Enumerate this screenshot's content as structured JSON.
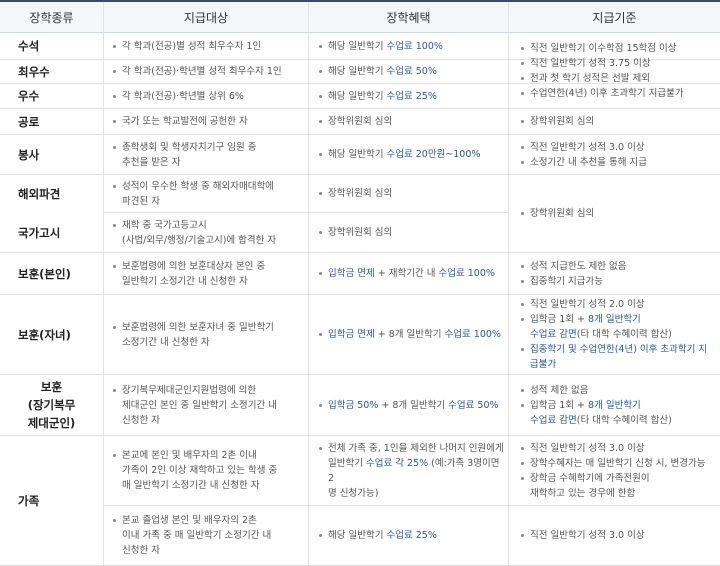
{
  "headers": [
    "장학종류",
    "지급대상",
    "장학혜택",
    "지급기준"
  ],
  "rows": {
    "r1_name": "수석",
    "r1_target": "각 학과(전공)별 성적 최우수자 1인",
    "r1_benefit_a": "해당 일반학기 ",
    "r1_benefit_b": "수업료 100%",
    "r2_name": "최우수",
    "r2_target": "각 학과(전공)·학년별 성적 최우수자 1인",
    "r2_benefit_a": "해당 일반학기 ",
    "r2_benefit_b": "수업료 50%",
    "r3_name": "우수",
    "r3_target": "각 학과(전공)·학년별 상위 6%",
    "r3_benefit_a": "해당 일반학기 ",
    "r3_benefit_b": "수업료 25%",
    "g1_criteria": [
      "직전 일반학기 이수학점 15학점 이상",
      "직전 일반학기 성적 3.75 이상",
      "전과 첫 학기 성적은 선발 제외",
      "수업연한(4년) 이후 초과학기 지급불가"
    ],
    "r4_name": "공로",
    "r4_target": "국가 또는 학교발전에 공헌한 자",
    "r4_benefit": "장학위원회 심의",
    "r4_criteria": "장학위원회 심의",
    "r5_name": "봉사",
    "r5_target_1": "총학생회 및 학생자치기구 임원 중",
    "r5_target_2": "추천을 받은 자",
    "r5_benefit_a": "해당 일반학기 ",
    "r5_benefit_b": "수업료 20만원~100%",
    "r5_criteria": [
      "직전 일반학기 성적 3.0 이상",
      "소정기간 내 추천을 통해 지급"
    ],
    "r6_name": "해외파견",
    "r6_target_1": "성적이 우수한 학생 중 해외자매대학에",
    "r6_target_2": "파견된 자",
    "r6_benefit": "장학위원회 심의",
    "r7_name": "국가고시",
    "r7_target_1": "재학 중 국가고등고시",
    "r7_target_2": "(사법/외무/행정/기술고시)에 합격한 자",
    "r7_benefit": "장학위원회 심의",
    "g2_criteria": "장학위원회 심의",
    "r8_name": "보훈(본인)",
    "r8_target_1": "보훈법령에 의한 보훈대상자 본인 중",
    "r8_target_2": "일반학기 소정기간 내 신청한 자",
    "r8_benefit_a": "입학금 면제",
    "r8_benefit_b": " + 재학기간 내 ",
    "r8_benefit_c": "수업료 100%",
    "r8_criteria": [
      "성적 지급한도 제한 없음",
      "집중학기 지급가능"
    ],
    "r9_name": "보훈(자녀)",
    "r9_target_1": "보훈법령에 의한 보훈자녀 중 일반학기",
    "r9_target_2": "소정기간 내 신청한 자",
    "r9_benefit_a": "입학금 면제",
    "r9_benefit_b": " + 8개 일반학기 ",
    "r9_benefit_c": "수업료 100%",
    "r9_c1": "직전 일반학기 성적 2.0 이상",
    "r9_c2a": "입학금 1회 + ",
    "r9_c2b": "8개 일반학기",
    "r9_c2c": "수업료 감면",
    "r9_c2d": "(타 대학 수혜이력 합산)",
    "r9_c3a": "집중학기 및 수업연한(4년) 이후 초과학기 지",
    "r9_c3b": "급불가",
    "r10_name_1": "보훈",
    "r10_name_2": "(장기복무",
    "r10_name_3": "제대군인)",
    "r10_target_1": "장기복무제대군인지원법령에 의한",
    "r10_target_2": "제대군인 본인 중 일반학기 소정기간 내",
    "r10_target_3": "신청한 자",
    "r10_benefit_a": "입학금 50%",
    "r10_benefit_b": " + 8개 일반학기 ",
    "r10_benefit_c": "수업료 50%",
    "r10_c1": "성적 제한 없음",
    "r10_c2a": "입학금 1회 + ",
    "r10_c2b": "8개 일반학기",
    "r10_c2c": "수업료 감면",
    "r10_c2d": "(타 대학 수혜이력 합산)",
    "r11_name": "가족",
    "r11a_target_1": "본교에 본인 및 배우자의 2촌 이내",
    "r11a_target_2": "가족이 2인 이상 재학하고 있는 학생 중",
    "r11a_target_3": "매 일반학기 소정기간 내 신청한 자",
    "r11a_benefit_1": "전체 가족 중, 1인을 제외한 나머지 인원에게",
    "r11a_benefit_2a": "일반학기 ",
    "r11a_benefit_2b": "수업료 각 25%",
    "r11a_benefit_2c": " (예:가족 3명이면 2",
    "r11a_benefit_3": "명 신청가능)",
    "r11a_c1": "직전 일반학기 성적 3.0 이상",
    "r11a_c2": "장학수혜자는 매 일반학기 신청 시, 변경가능",
    "r11a_c3a": "장학금 수혜학기에 가족전원이",
    "r11a_c3b": "재학하고 있는 경우에 한함",
    "r11b_target_1": "본교 졸업생 본인 및 배우자의 2촌",
    "r11b_target_2": "이내 가족 중 매 일반학기 소정기간 내",
    "r11b_target_3": "신청한 자",
    "r11b_benefit_a": "해당 일반학기 ",
    "r11b_benefit_b": "수업료 25%",
    "r11b_criteria": "직전 일반학기 성적 3.0 이상"
  }
}
